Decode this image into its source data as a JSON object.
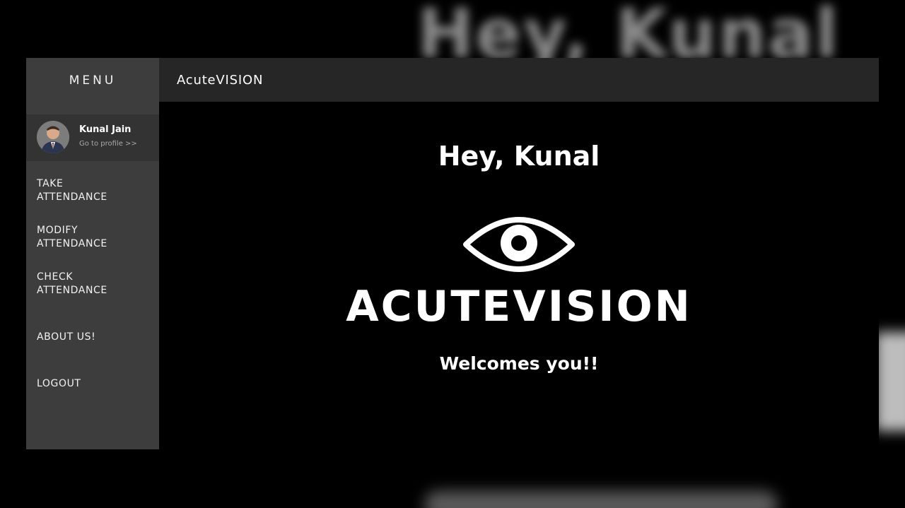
{
  "background": {
    "headline": "Hey, Kunal"
  },
  "sidebar": {
    "title": "MENU",
    "profile": {
      "name": "Kunal Jain",
      "link": "Go to profile >>"
    },
    "items": [
      {
        "line1": "TAKE",
        "line2": "ATTENDANCE"
      },
      {
        "line1": "MODIFY",
        "line2": "ATTENDANCE"
      },
      {
        "line1": "CHECK",
        "line2": "ATTENDANCE"
      },
      {
        "line1": "ABOUT US!",
        "line2": ""
      },
      {
        "line1": "LOGOUT",
        "line2": ""
      }
    ]
  },
  "header": {
    "brand": "AcuteVISION"
  },
  "main": {
    "greeting": "Hey, Kunal",
    "logo_icon": "eye-icon",
    "logo_text": "ACUTEVISION",
    "tagline": "Welcomes you!!"
  },
  "colors": {
    "page_background": "#000000",
    "sidebar": "#3d3d3d",
    "profile_card": "#333333",
    "topbar": "#262626",
    "text": "#ffffff",
    "muted_text": "#aaaaaa"
  }
}
